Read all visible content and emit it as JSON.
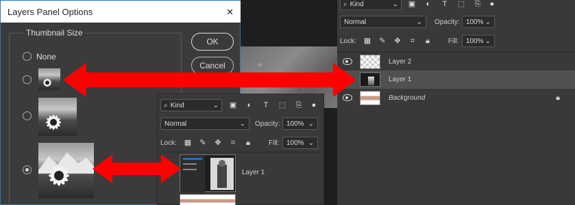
{
  "dialog": {
    "title": "Layers Panel Options",
    "close_glyph": "✕",
    "group_label": "Thumbnail Size",
    "options": [
      {
        "label": "None",
        "checked": false
      },
      {
        "label": "",
        "checked": false
      },
      {
        "label": "",
        "checked": false
      },
      {
        "label": "",
        "checked": true
      }
    ],
    "ok_label": "OK",
    "cancel_label": "Cancel"
  },
  "layers_panel_right": {
    "filter_kind": "Kind",
    "blend_mode": "Normal",
    "opacity_label": "Opacity:",
    "opacity_value": "100%",
    "lock_label": "Lock:",
    "fill_label": "Fill:",
    "fill_value": "100%",
    "layers": [
      {
        "name": "Layer 2",
        "visible": true,
        "selected": false
      },
      {
        "name": "Layer 1",
        "visible": false,
        "selected": true
      },
      {
        "name": "Background",
        "visible": true,
        "selected": false,
        "locked": true
      }
    ]
  },
  "layers_panel_left": {
    "filter_kind": "Kind",
    "blend_mode": "Normal",
    "opacity_label": "Opacity:",
    "opacity_value": "100%",
    "lock_label": "Lock:",
    "fill_label": "Fill:",
    "fill_value": "100%",
    "layers": [
      {
        "name": "Layer 1"
      }
    ]
  },
  "colors": {
    "arrow": "#ff0000",
    "dialog_bg": "#3b3b3b",
    "panel_bg": "#393939",
    "selected_row": "#505050",
    "dialog_border": "#2a74c5"
  },
  "icons": [
    "search-icon",
    "image-filter-icon",
    "adjustment-filter-icon",
    "type-filter-icon",
    "shape-filter-icon",
    "smart-object-filter-icon",
    "filter-toggle-icon",
    "lock-transparency-icon",
    "lock-paint-icon",
    "lock-position-icon",
    "lock-artboard-icon",
    "lock-all-icon",
    "eye-icon",
    "lock-icon",
    "chevron-down-icon",
    "close-icon"
  ]
}
